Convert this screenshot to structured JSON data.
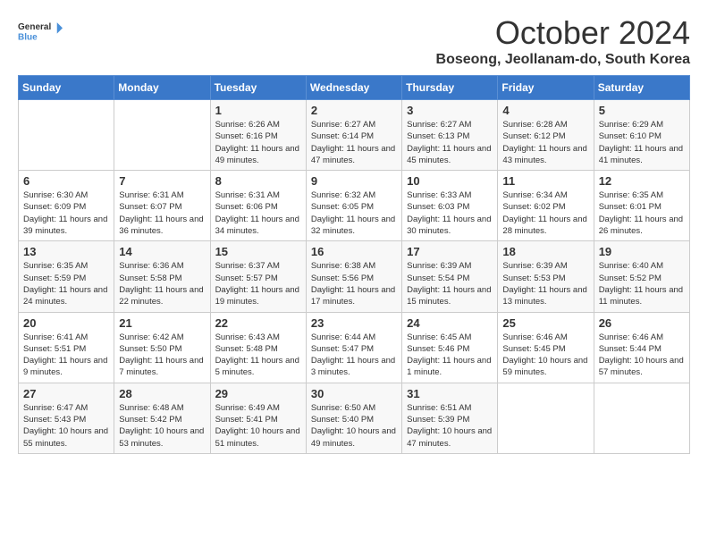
{
  "logo": {
    "line1": "General",
    "line2": "Blue"
  },
  "title": "October 2024",
  "subtitle": "Boseong, Jeollanam-do, South Korea",
  "days_of_week": [
    "Sunday",
    "Monday",
    "Tuesday",
    "Wednesday",
    "Thursday",
    "Friday",
    "Saturday"
  ],
  "weeks": [
    [
      {
        "day": "",
        "info": ""
      },
      {
        "day": "",
        "info": ""
      },
      {
        "day": "1",
        "info": "Sunrise: 6:26 AM\nSunset: 6:16 PM\nDaylight: 11 hours and 49 minutes."
      },
      {
        "day": "2",
        "info": "Sunrise: 6:27 AM\nSunset: 6:14 PM\nDaylight: 11 hours and 47 minutes."
      },
      {
        "day": "3",
        "info": "Sunrise: 6:27 AM\nSunset: 6:13 PM\nDaylight: 11 hours and 45 minutes."
      },
      {
        "day": "4",
        "info": "Sunrise: 6:28 AM\nSunset: 6:12 PM\nDaylight: 11 hours and 43 minutes."
      },
      {
        "day": "5",
        "info": "Sunrise: 6:29 AM\nSunset: 6:10 PM\nDaylight: 11 hours and 41 minutes."
      }
    ],
    [
      {
        "day": "6",
        "info": "Sunrise: 6:30 AM\nSunset: 6:09 PM\nDaylight: 11 hours and 39 minutes."
      },
      {
        "day": "7",
        "info": "Sunrise: 6:31 AM\nSunset: 6:07 PM\nDaylight: 11 hours and 36 minutes."
      },
      {
        "day": "8",
        "info": "Sunrise: 6:31 AM\nSunset: 6:06 PM\nDaylight: 11 hours and 34 minutes."
      },
      {
        "day": "9",
        "info": "Sunrise: 6:32 AM\nSunset: 6:05 PM\nDaylight: 11 hours and 32 minutes."
      },
      {
        "day": "10",
        "info": "Sunrise: 6:33 AM\nSunset: 6:03 PM\nDaylight: 11 hours and 30 minutes."
      },
      {
        "day": "11",
        "info": "Sunrise: 6:34 AM\nSunset: 6:02 PM\nDaylight: 11 hours and 28 minutes."
      },
      {
        "day": "12",
        "info": "Sunrise: 6:35 AM\nSunset: 6:01 PM\nDaylight: 11 hours and 26 minutes."
      }
    ],
    [
      {
        "day": "13",
        "info": "Sunrise: 6:35 AM\nSunset: 5:59 PM\nDaylight: 11 hours and 24 minutes."
      },
      {
        "day": "14",
        "info": "Sunrise: 6:36 AM\nSunset: 5:58 PM\nDaylight: 11 hours and 22 minutes."
      },
      {
        "day": "15",
        "info": "Sunrise: 6:37 AM\nSunset: 5:57 PM\nDaylight: 11 hours and 19 minutes."
      },
      {
        "day": "16",
        "info": "Sunrise: 6:38 AM\nSunset: 5:56 PM\nDaylight: 11 hours and 17 minutes."
      },
      {
        "day": "17",
        "info": "Sunrise: 6:39 AM\nSunset: 5:54 PM\nDaylight: 11 hours and 15 minutes."
      },
      {
        "day": "18",
        "info": "Sunrise: 6:39 AM\nSunset: 5:53 PM\nDaylight: 11 hours and 13 minutes."
      },
      {
        "day": "19",
        "info": "Sunrise: 6:40 AM\nSunset: 5:52 PM\nDaylight: 11 hours and 11 minutes."
      }
    ],
    [
      {
        "day": "20",
        "info": "Sunrise: 6:41 AM\nSunset: 5:51 PM\nDaylight: 11 hours and 9 minutes."
      },
      {
        "day": "21",
        "info": "Sunrise: 6:42 AM\nSunset: 5:50 PM\nDaylight: 11 hours and 7 minutes."
      },
      {
        "day": "22",
        "info": "Sunrise: 6:43 AM\nSunset: 5:48 PM\nDaylight: 11 hours and 5 minutes."
      },
      {
        "day": "23",
        "info": "Sunrise: 6:44 AM\nSunset: 5:47 PM\nDaylight: 11 hours and 3 minutes."
      },
      {
        "day": "24",
        "info": "Sunrise: 6:45 AM\nSunset: 5:46 PM\nDaylight: 11 hours and 1 minute."
      },
      {
        "day": "25",
        "info": "Sunrise: 6:46 AM\nSunset: 5:45 PM\nDaylight: 10 hours and 59 minutes."
      },
      {
        "day": "26",
        "info": "Sunrise: 6:46 AM\nSunset: 5:44 PM\nDaylight: 10 hours and 57 minutes."
      }
    ],
    [
      {
        "day": "27",
        "info": "Sunrise: 6:47 AM\nSunset: 5:43 PM\nDaylight: 10 hours and 55 minutes."
      },
      {
        "day": "28",
        "info": "Sunrise: 6:48 AM\nSunset: 5:42 PM\nDaylight: 10 hours and 53 minutes."
      },
      {
        "day": "29",
        "info": "Sunrise: 6:49 AM\nSunset: 5:41 PM\nDaylight: 10 hours and 51 minutes."
      },
      {
        "day": "30",
        "info": "Sunrise: 6:50 AM\nSunset: 5:40 PM\nDaylight: 10 hours and 49 minutes."
      },
      {
        "day": "31",
        "info": "Sunrise: 6:51 AM\nSunset: 5:39 PM\nDaylight: 10 hours and 47 minutes."
      },
      {
        "day": "",
        "info": ""
      },
      {
        "day": "",
        "info": ""
      }
    ]
  ]
}
